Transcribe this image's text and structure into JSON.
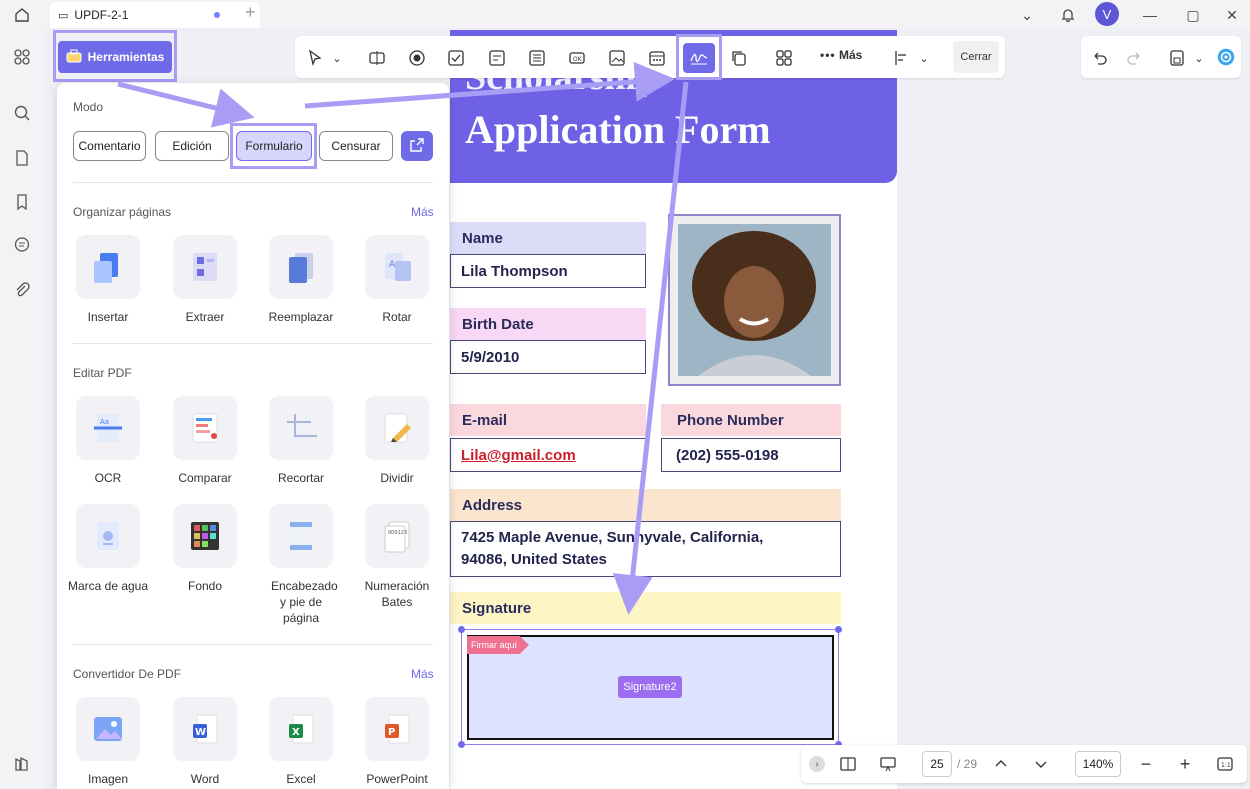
{
  "tab": {
    "title": "UPDF-2-1"
  },
  "user": {
    "initial": "V"
  },
  "herramientas": {
    "label": "Herramientas"
  },
  "toolbar": {
    "mas_label": "Más",
    "cerrar_label": "Cerrar"
  },
  "panel": {
    "modo_title": "Modo",
    "modes": [
      "Comentario",
      "Edición",
      "Formulario",
      "Censurar"
    ],
    "organize": {
      "title": "Organizar páginas",
      "more": "Más",
      "tools": [
        "Insertar",
        "Extraer",
        "Reemplazar",
        "Rotar"
      ]
    },
    "edit": {
      "title": "Editar PDF",
      "tools": [
        "OCR",
        "Comparar",
        "Recortar",
        "Dividir"
      ],
      "tools2": [
        "Marca de agua",
        "Fondo",
        "Encabezado y pie de página",
        "Numeración Bates"
      ]
    },
    "convert": {
      "title": "Convertidor De PDF",
      "more": "Más",
      "tools": [
        "Imagen",
        "Word",
        "Excel",
        "PowerPoint"
      ]
    }
  },
  "form": {
    "title_line1": "Scholarship",
    "title_line2": "Application Form",
    "name_label": "Name",
    "name_value": "Lila Thompson",
    "birth_label": "Birth Date",
    "birth_value": "5/9/2010",
    "email_label": "E-mail",
    "email_value": "Lila@gmail.com",
    "phone_label": "Phone Number",
    "phone_value": "(202) 555-0198",
    "address_label": "Address",
    "address_line1": "7425 Maple Avenue, Sunnyvale, California,",
    "address_line2": "94086, United States",
    "signature_label": "Signature",
    "sign_tag": "Firmar aquí",
    "sign_chip": "Signature2"
  },
  "bottom": {
    "page": "25",
    "total": "/ 29",
    "zoom": "140%"
  },
  "colors": {
    "accent": "#6e6ae8",
    "highlight": "#a99cf5",
    "banner": "#6e61e6"
  }
}
